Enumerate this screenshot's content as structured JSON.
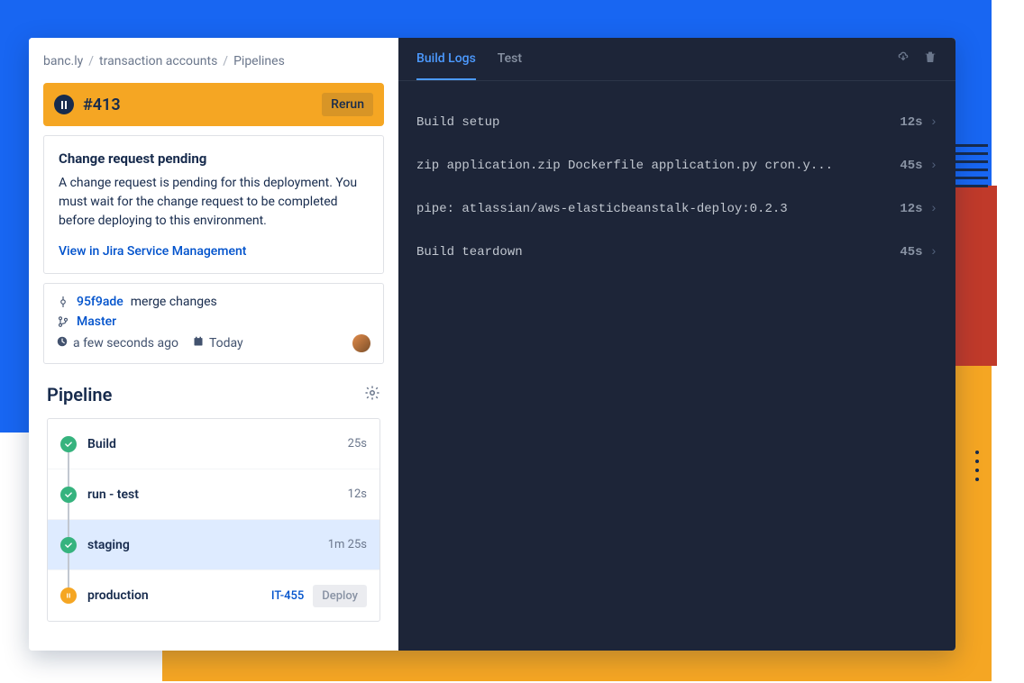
{
  "breadcrumb": {
    "project": "banc.ly",
    "repo": "transaction accounts",
    "page": "Pipelines"
  },
  "run": {
    "id": "#413",
    "rerun_label": "Rerun"
  },
  "notice": {
    "title": "Change request pending",
    "body": "A change request is pending for this deployment. You must wait for the change request to be completed before deploying to this environment.",
    "link_label": "View in Jira Service Management"
  },
  "commit": {
    "hash": "95f9ade",
    "message": "merge changes",
    "branch": "Master",
    "time_ago": "a few seconds ago",
    "date": "Today"
  },
  "pipeline": {
    "heading": "Pipeline",
    "stages": [
      {
        "name": "Build",
        "duration": "25s",
        "status": "ok"
      },
      {
        "name": "run - test",
        "duration": "12s",
        "status": "ok"
      },
      {
        "name": "staging",
        "duration": "1m 25s",
        "status": "ok"
      },
      {
        "name": "production",
        "status": "pause",
        "ticket": "IT-455",
        "deploy_label": "Deploy"
      }
    ]
  },
  "right": {
    "tabs": {
      "build_logs": "Build Logs",
      "test": "Test"
    },
    "logs": [
      {
        "text": "Build setup",
        "dur": "12s"
      },
      {
        "text": "zip application.zip Dockerfile application.py cron.y...",
        "dur": "45s"
      },
      {
        "text": "pipe: atlassian/aws-elasticbeanstalk-deploy:0.2.3",
        "dur": "12s"
      },
      {
        "text": "Build teardown",
        "dur": "45s"
      }
    ]
  }
}
